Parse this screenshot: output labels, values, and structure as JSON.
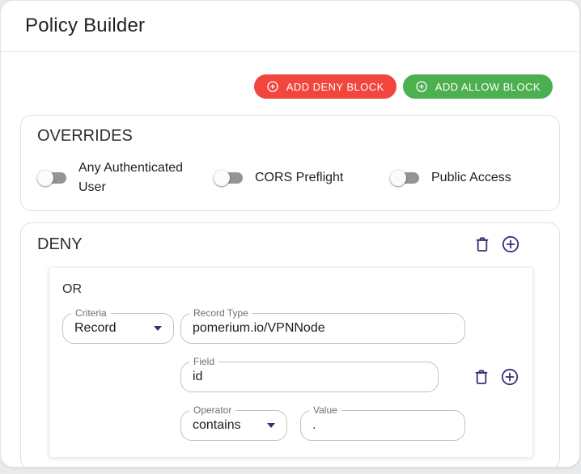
{
  "page": {
    "title": "Policy Builder"
  },
  "toolbar": {
    "add_deny_label": "ADD DENY BLOCK",
    "add_allow_label": "ADD ALLOW BLOCK"
  },
  "overrides": {
    "title": "OVERRIDES",
    "toggles": [
      {
        "label": "Any Authenticated User",
        "state": "off"
      },
      {
        "label": "CORS Preflight",
        "state": "off"
      },
      {
        "label": "Public Access",
        "state": "off"
      }
    ]
  },
  "deny_block": {
    "title": "DENY",
    "group": {
      "operator_label": "OR",
      "fields": {
        "criteria": {
          "label": "Criteria",
          "value": "Record"
        },
        "record_type": {
          "label": "Record Type",
          "value": "pomerium.io/VPNNode"
        },
        "field": {
          "label": "Field",
          "value": "id"
        },
        "operator": {
          "label": "Operator",
          "value": "contains"
        },
        "value": {
          "label": "Value",
          "value": "."
        }
      }
    }
  },
  "icons": {
    "button_plus": "plus-circle-icon",
    "delete": "trash-icon",
    "add_row": "plus-circle-icon"
  },
  "colors": {
    "deny_red": "#f2453d",
    "allow_green": "#4caf50",
    "icon_indigo": "#3b2e79",
    "toggle_track_gray": "#949494",
    "page_background": "#e9eaec"
  }
}
